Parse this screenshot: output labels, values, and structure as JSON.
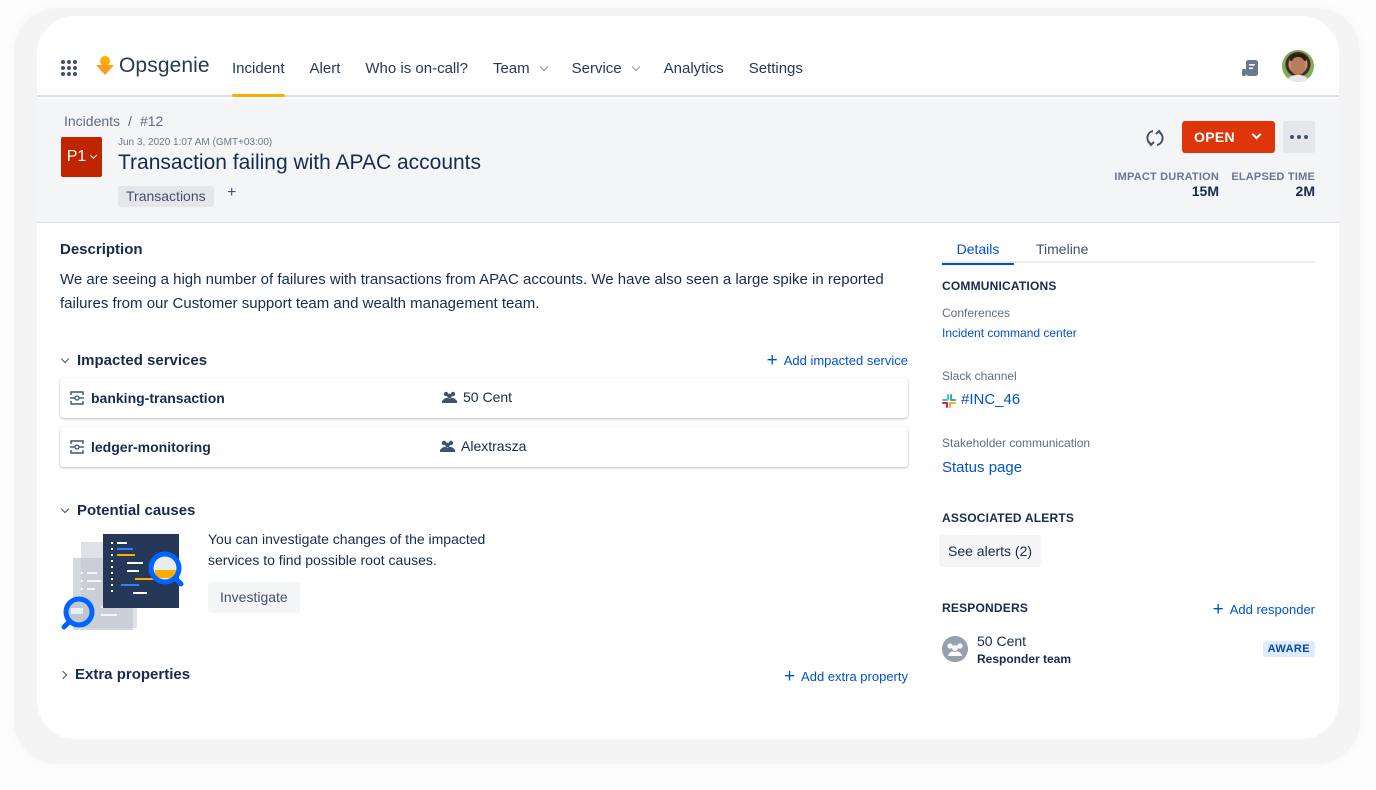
{
  "nav": {
    "app_switcher_icon": "app-grid-icon",
    "brand": "Opsgenie",
    "items": [
      {
        "label": "Incident",
        "active": true,
        "has_dropdown": false
      },
      {
        "label": "Alert",
        "active": false,
        "has_dropdown": false
      },
      {
        "label": "Who is on-call?",
        "active": false,
        "has_dropdown": false
      },
      {
        "label": "Team",
        "active": false,
        "has_dropdown": true
      },
      {
        "label": "Service",
        "active": false,
        "has_dropdown": true
      },
      {
        "label": "Analytics",
        "active": false,
        "has_dropdown": false
      },
      {
        "label": "Settings",
        "active": false,
        "has_dropdown": false
      }
    ],
    "right_icons": [
      "docs-icon",
      "user-avatar"
    ],
    "accent_color": "#ffab00"
  },
  "header": {
    "breadcrumb": [
      "Incidents",
      "/",
      "#12"
    ],
    "priority": "P1",
    "priority_color": "#bf2600",
    "timestamp": "Jun 3, 2020 1:07 AM (GMT+03:00)",
    "title": "Transaction failing with APAC accounts",
    "tags": [
      "Transactions"
    ],
    "add_tag_label": "+",
    "status_button": "OPEN",
    "status_color": "#de350b",
    "metrics": [
      {
        "label": "IMPACT DURATION",
        "value": "15M"
      },
      {
        "label": "ELAPSED TIME",
        "value": "2M"
      }
    ]
  },
  "description": {
    "heading": "Description",
    "text": "We are seeing a high number of failures with transactions from APAC accounts. We have also seen a large spike in reported failures from our Customer support team and wealth management team."
  },
  "impacted_services": {
    "heading": "Impacted services",
    "add_label": "Add impacted service",
    "rows": [
      {
        "name": "banking-transaction",
        "team": "50 Cent"
      },
      {
        "name": "ledger-monitoring",
        "team": "Alextrasza"
      }
    ]
  },
  "potential_causes": {
    "heading": "Potential causes",
    "text": "You can investigate changes of the impacted services to find possible root causes.",
    "button": "Investigate"
  },
  "extra_properties": {
    "heading": "Extra properties",
    "add_label": "Add extra property"
  },
  "sidebar": {
    "tabs": [
      {
        "label": "Details",
        "active": true
      },
      {
        "label": "Timeline",
        "active": false
      }
    ],
    "communications": {
      "heading": "COMMUNICATIONS",
      "conferences_label": "Conferences",
      "conference_link": "Incident command center",
      "slack_label": "Slack channel",
      "slack_channel": "#INC_46",
      "stakeholder_label": "Stakeholder communication",
      "stakeholder_link": "Status page"
    },
    "associated_alerts": {
      "heading": "ASSOCIATED ALERTS",
      "button": "See alerts (2)"
    },
    "responders": {
      "heading": "RESPONDERS",
      "add_label": "Add responder",
      "items": [
        {
          "name": "50 Cent",
          "role": "Responder team",
          "status": "AWARE"
        }
      ]
    }
  }
}
